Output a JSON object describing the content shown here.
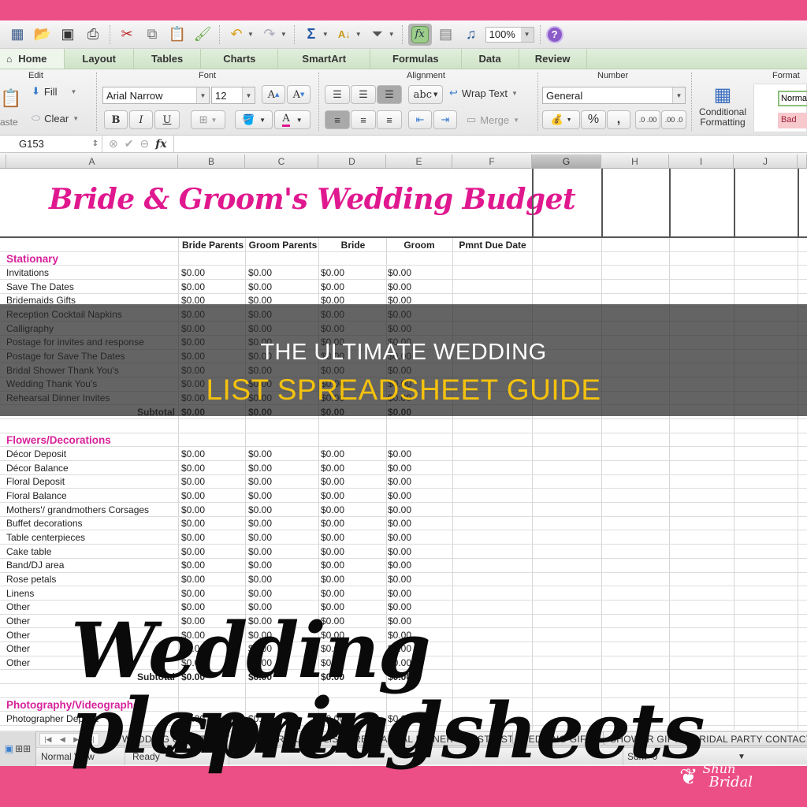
{
  "overlay": {
    "line1": "THE ULTIMATE WEDDING",
    "line2": "LIST SPREADSHEET GUIDE",
    "script_line1": "Wedding planning",
    "script_line2": "spreadsheets",
    "brand_line1": "Shun",
    "brand_line2": "Bridal",
    "brand_icon": "laurel-wreath-icon"
  },
  "colors": {
    "background_pink": "#ec4f86",
    "title_magenta": "#e0188f",
    "section_magenta": "#d6229a",
    "guide_yellow": "#f4c20d"
  },
  "toolbar": {
    "icons": [
      "gallery-icon",
      "open-icon",
      "save-icon",
      "print-icon",
      "cut-icon",
      "copy-icon",
      "paste-icon",
      "format-painter-icon",
      "undo-icon",
      "redo-icon",
      "autosum-icon",
      "sort-icon",
      "filter-icon",
      "formula-builder-icon",
      "toolbox-icon",
      "media-browser-icon",
      "help-icon"
    ],
    "zoom": "100%"
  },
  "ribbon_tabs": [
    "Home",
    "Layout",
    "Tables",
    "Charts",
    "SmartArt",
    "Formulas",
    "Data",
    "Review"
  ],
  "ribbon": {
    "edit": {
      "title": "Edit",
      "paste": "aste",
      "fill": "Fill",
      "clear": "Clear"
    },
    "font": {
      "title": "Font",
      "name": "Arial Narrow",
      "size": "12",
      "bold": "B",
      "italic": "I",
      "underline": "U",
      "grow": "A",
      "shrink": "A",
      "font_color": "A"
    },
    "alignment": {
      "title": "Alignment",
      "orientation": "abc",
      "wrap_text": "Wrap Text",
      "merge": "Merge"
    },
    "number": {
      "title": "Number",
      "format": "General",
      "percent": "%",
      "comma": ",",
      "inc_decimal": ".0 .00",
      "dec_decimal": ".00 .0",
      "conditional_formatting": "Conditional Formatting"
    },
    "format": {
      "title": "Format",
      "style_normal": "Norma",
      "style_bad": "Bad"
    }
  },
  "formula_bar": {
    "cell_ref": "G153",
    "fx": "fx",
    "value": ""
  },
  "columns": [
    "A",
    "B",
    "C",
    "D",
    "E",
    "F",
    "G",
    "H",
    "I",
    "J"
  ],
  "selected_column": "G",
  "sheet": {
    "title": "Bride & Groom's Wedding Budget",
    "headers": [
      "",
      "Bride Parents",
      "Groom Parents",
      "Bride",
      "Groom",
      "Pmnt Due Date"
    ],
    "sections": [
      {
        "name": "Stationary",
        "items": [
          [
            "Invitations",
            "$0.00",
            "$0.00",
            "$0.00",
            "$0.00"
          ],
          [
            "Save The Dates",
            "$0.00",
            "$0.00",
            "$0.00",
            "$0.00"
          ],
          [
            "Bridemaids Gifts",
            "$0.00",
            "$0.00",
            "$0.00",
            "$0.00"
          ],
          [
            "Reception Cocktail Napkins",
            "$0.00",
            "$0.00",
            "$0.00",
            "$0.00"
          ],
          [
            "Calligraphy",
            "$0.00",
            "$0.00",
            "$0.00",
            "$0.00"
          ],
          [
            "Postage for invites and response",
            "$0.00",
            "$0.00",
            "$0.00",
            "$0.00"
          ],
          [
            "Postage for Save The Dates",
            "$0.00",
            "$0.00",
            "$0.00",
            "$0.00"
          ],
          [
            "Bridal Shower Thank You's",
            "$0.00",
            "$0.00",
            "$0.00",
            "$0.00"
          ],
          [
            "Wedding Thank You's",
            "$0.00",
            "$0.00",
            "$0.00",
            "$0.00"
          ],
          [
            "Rehearsal Dinner Invites",
            "$0.00",
            "$0.00",
            "$0.00",
            "$0.00"
          ]
        ],
        "subtotal": [
          "Subtotal",
          "$0.00",
          "$0.00",
          "$0.00",
          "$0.00"
        ]
      },
      {
        "name": "Flowers/Decorations",
        "items": [
          [
            "Décor Deposit",
            "$0.00",
            "$0.00",
            "$0.00",
            "$0.00"
          ],
          [
            "Décor Balance",
            "$0.00",
            "$0.00",
            "$0.00",
            "$0.00"
          ],
          [
            "Floral Deposit",
            "$0.00",
            "$0.00",
            "$0.00",
            "$0.00"
          ],
          [
            "Floral Balance",
            "$0.00",
            "$0.00",
            "$0.00",
            "$0.00"
          ],
          [
            "Mothers'/ grandmothers Corsages",
            "$0.00",
            "$0.00",
            "$0.00",
            "$0.00"
          ],
          [
            "Buffet decorations",
            "$0.00",
            "$0.00",
            "$0.00",
            "$0.00"
          ],
          [
            "Table centerpieces",
            "$0.00",
            "$0.00",
            "$0.00",
            "$0.00"
          ],
          [
            "Cake table",
            "$0.00",
            "$0.00",
            "$0.00",
            "$0.00"
          ],
          [
            "Band/DJ area",
            "$0.00",
            "$0.00",
            "$0.00",
            "$0.00"
          ],
          [
            "Rose petals",
            "$0.00",
            "$0.00",
            "$0.00",
            "$0.00"
          ],
          [
            "Linens",
            "$0.00",
            "$0.00",
            "$0.00",
            "$0.00"
          ],
          [
            "Other",
            "$0.00",
            "$0.00",
            "$0.00",
            "$0.00"
          ],
          [
            "Other",
            "$0.00",
            "$0.00",
            "$0.00",
            "$0.00"
          ],
          [
            "Other",
            "$0.00",
            "$0.00",
            "$0.00",
            "$0.00"
          ],
          [
            "Other",
            "$0.00",
            "$0.00",
            "$0.00",
            "$0.00"
          ],
          [
            "Other",
            "$0.00",
            "$0.00",
            "$0.00",
            "$0.00"
          ]
        ],
        "subtotal": [
          "Subtotal",
          "$0.00",
          "$0.00",
          "$0.00",
          "$0.00"
        ]
      },
      {
        "name": "Photography/Videographer",
        "items": [
          [
            "Photographer Deposit",
            "$0.00",
            "$0.00",
            "$0.00",
            "$0.00"
          ]
        ]
      }
    ]
  },
  "sheet_tabs": [
    "WEDDING GUEST LIST",
    "SHOWER GUEST LIST",
    "REHEARSAL DINNER GUEST LIST",
    "WEDDING GIFTS",
    "SHOWER GIFTS",
    "BRIDAL PARTY CONTACT"
  ],
  "status_bar": {
    "view": "Normal View",
    "state": "Ready",
    "sum": "Sum=0"
  }
}
